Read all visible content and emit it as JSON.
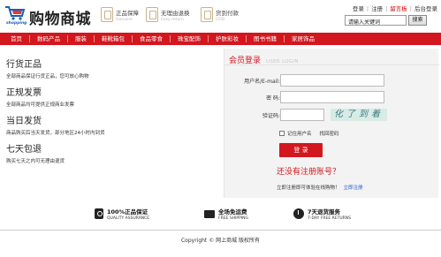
{
  "header": {
    "logo_label": "shopping",
    "site_name": "购物商城",
    "guarantees": [
      {
        "title": "正品保障",
        "sub": "Genuine"
      },
      {
        "title": "无理由退换",
        "sub": "Easy return"
      },
      {
        "title": "货到付款",
        "sub": "COD"
      }
    ],
    "top_links": {
      "login": "登录",
      "register": "注册",
      "message": "留言板",
      "backend": "后台登录"
    },
    "search": {
      "value": "请输入关键词",
      "button": "搜索"
    }
  },
  "nav": {
    "items": [
      "首页",
      "数码产品",
      "服装",
      "鞋靴箱包",
      "食品零食",
      "珠宝配饰",
      "护肤彩妆",
      "图书书籍",
      "家居饰品"
    ]
  },
  "features": [
    {
      "title": "行货正品",
      "desc": "全部商品保证行货正品，您可放心购物"
    },
    {
      "title": "正规发票",
      "desc": "全部商品均可提供正规商业发票"
    },
    {
      "title": "当日发货",
      "desc": "商品购买后当天发货，部分地区24小时内到货"
    },
    {
      "title": "七天包退",
      "desc": "购买七天之内可无理由退货"
    }
  ],
  "login": {
    "title": "会员登录",
    "title_en": "USER LOGIN",
    "username_label": "用户名/E-mail:",
    "password_label": "密  码:",
    "captcha_label": "验证码:",
    "captcha_text": "化了到着",
    "remember_label": "记住用户名",
    "forgot_label": "找回密码",
    "submit_label": "登 录",
    "register_question": "还没有注册账号？",
    "register_prompt": "立即注册即可体验在线购物！",
    "register_link": "立即注册"
  },
  "services": [
    {
      "title": "100%正品保证",
      "sub": "QUALITY ASSURANCE",
      "icon": "shield-icon"
    },
    {
      "title": "全场免运费",
      "sub": "FREE SHIPPING",
      "icon": "truck-icon"
    },
    {
      "title": "7天退货服务",
      "sub": "7-DAY FREE RETURNS",
      "icon": "clock-icon"
    }
  ],
  "footer": {
    "copyright": "Copyright © 网上商城 版权所有"
  },
  "colors": {
    "accent": "#d2171e",
    "link": "#1d56c5"
  }
}
